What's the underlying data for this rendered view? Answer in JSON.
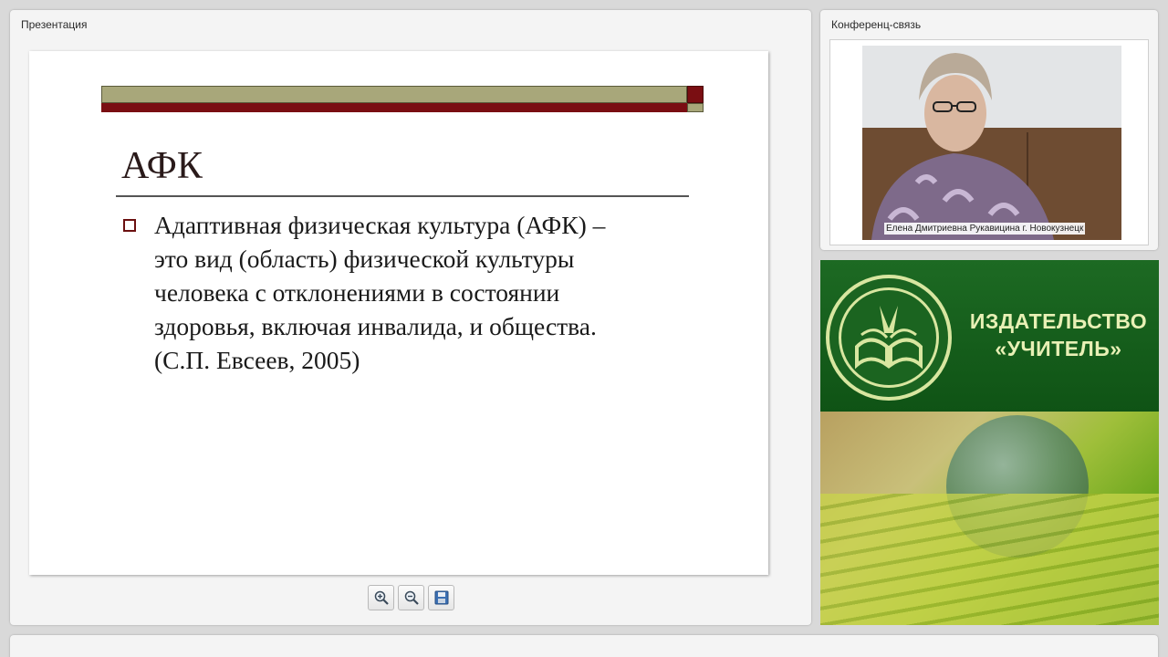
{
  "presentation": {
    "panel_title": "Презентация",
    "slide": {
      "title": "АФК",
      "bullet_lines": [
        "Адаптивная физическая культура (АФК) –",
        "это вид (область) физической культуры",
        "человека с отклонениями в состоянии",
        "здоровья, включая инвалида, и общества.",
        "(С.П. Евсеев, 2005)"
      ]
    },
    "toolbar": {
      "zoom_in_icon": "zoom-in-icon",
      "zoom_out_icon": "zoom-out-icon",
      "save_icon": "save-icon"
    }
  },
  "conference": {
    "panel_title": "Конференц-связь",
    "video_caption": "Елена Дмитриевна Рукавицина г. Новокузнецк"
  },
  "banner": {
    "line1": "ИЗДАТЕЛЬСТВО",
    "line2": "«УЧИТЕЛЬ»"
  },
  "colors": {
    "slide_accent_red": "#7a0e12",
    "slide_accent_olive": "#a8a77a",
    "banner_green": "#1d6a23",
    "banner_text": "#e8f0b5"
  }
}
